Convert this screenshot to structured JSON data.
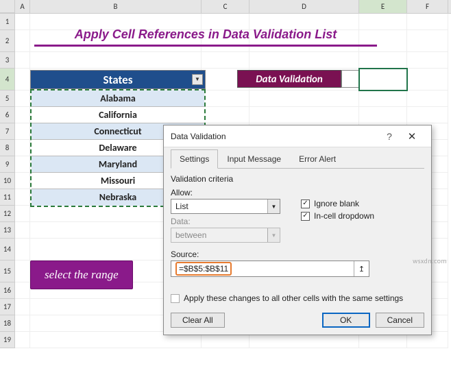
{
  "columns": [
    "A",
    "B",
    "C",
    "D",
    "E",
    "F"
  ],
  "row_numbers": [
    1,
    2,
    3,
    4,
    5,
    6,
    7,
    8,
    9,
    10,
    11,
    12,
    13,
    14,
    15,
    16,
    17,
    18,
    19
  ],
  "title": "Apply Cell References in Data Validation List",
  "states_header": "States",
  "states": [
    "Alabama",
    "California",
    "Connecticut",
    "Delaware",
    "Maryland",
    "Missouri",
    "Nebraska"
  ],
  "dv_cell_label": "Data Validation",
  "note_text": "select the range",
  "selected_cell": "E4",
  "dialog": {
    "title": "Data Validation",
    "tabs": {
      "settings": "Settings",
      "input_message": "Input Message",
      "error_alert": "Error Alert"
    },
    "active_tab": "Settings",
    "criteria_label": "Validation criteria",
    "allow_label": "Allow:",
    "allow_value": "List",
    "data_label": "Data:",
    "data_value": "between",
    "ignore_blank_label": "Ignore blank",
    "ignore_blank_checked": true,
    "incell_label": "In-cell dropdown",
    "incell_checked": true,
    "source_label": "Source:",
    "source_value": "=$B$5:$B$11",
    "apply_label": "Apply these changes to all other cells with the same settings",
    "apply_checked": false,
    "clear_all": "Clear All",
    "ok": "OK",
    "cancel": "Cancel"
  },
  "watermark": "wsxdn.com"
}
